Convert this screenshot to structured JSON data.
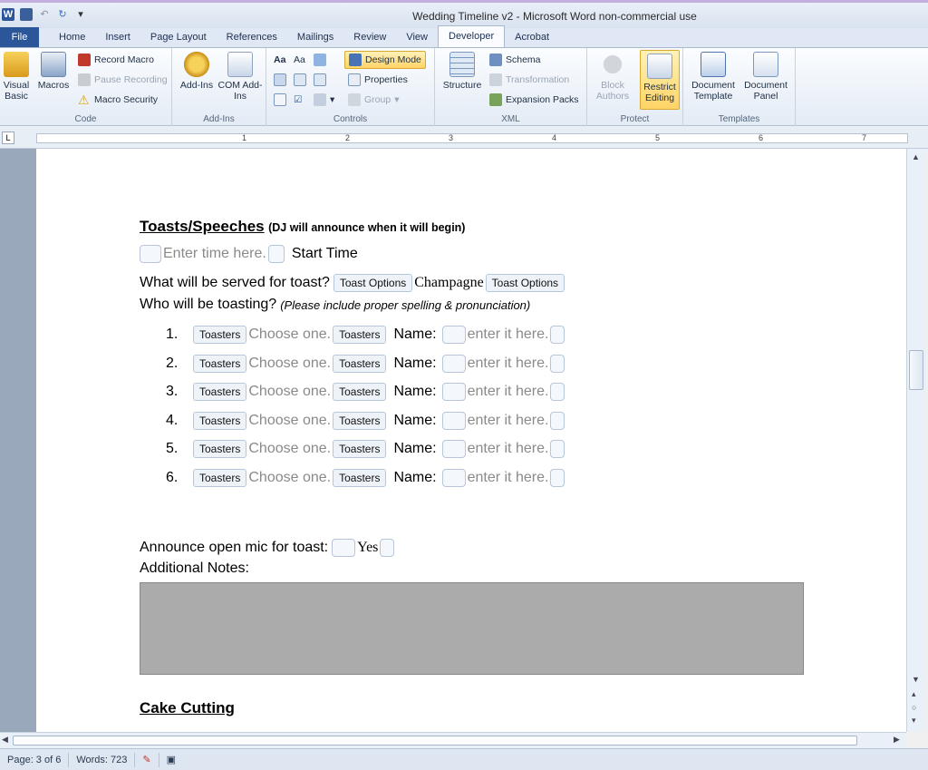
{
  "window": {
    "title": "Wedding Timeline v2 - Microsoft Word non-commercial use"
  },
  "tabs": [
    "File",
    "Home",
    "Insert",
    "Page Layout",
    "References",
    "Mailings",
    "Review",
    "View",
    "Developer",
    "Acrobat"
  ],
  "ribbon": {
    "code": {
      "name": "Code",
      "visual_basic": "Visual Basic",
      "macros": "Macros",
      "record_macro": "Record Macro",
      "pause_recording": "Pause Recording",
      "macro_security": "Macro Security"
    },
    "addins": {
      "name": "Add-Ins",
      "addins": "Add-Ins",
      "com_addins": "COM Add-Ins"
    },
    "controls": {
      "name": "Controls",
      "design_mode": "Design Mode",
      "properties": "Properties",
      "group": "Group"
    },
    "xml": {
      "name": "XML",
      "structure": "Structure",
      "schema": "Schema",
      "transformation": "Transformation",
      "expansion_packs": "Expansion Packs"
    },
    "protect": {
      "name": "Protect",
      "block_authors": "Block Authors",
      "restrict_editing": "Restrict Editing"
    },
    "templates": {
      "name": "Templates",
      "document_template": "Document Template",
      "document_panel": "Document Panel"
    }
  },
  "ruler": {
    "numbers": [
      "1",
      "2",
      "3",
      "4",
      "5",
      "6",
      "7"
    ]
  },
  "document": {
    "toasts_heading": "Toasts/Speeches",
    "toasts_note": "(DJ will announce when it will begin)",
    "time_placeholder": "Enter time here.",
    "start_time": "Start Time",
    "served_question": "What will be served for toast?",
    "toast_options_label": "Toast Options",
    "toast_value": "Champagne",
    "who_question": "Who will be toasting?",
    "who_note": "(Please include proper spelling & pronunciation)",
    "toasters": [
      {
        "num": "1.",
        "tag": "Toasters",
        "choice": "Choose one.",
        "name_label": "Name:",
        "name_placeholder": "enter it here."
      },
      {
        "num": "2.",
        "tag": "Toasters",
        "choice": "Choose one.",
        "name_label": "Name:",
        "name_placeholder": "enter it here."
      },
      {
        "num": "3.",
        "tag": "Toasters",
        "choice": "Choose one.",
        "name_label": "Name:",
        "name_placeholder": "enter it here."
      },
      {
        "num": "4.",
        "tag": "Toasters",
        "choice": "Choose one.",
        "name_label": "Name:",
        "name_placeholder": "enter it here."
      },
      {
        "num": "5.",
        "tag": "Toasters",
        "choice": "Choose one.",
        "name_label": "Name:",
        "name_placeholder": "enter it here."
      },
      {
        "num": "6.",
        "tag": "Toasters",
        "choice": "Choose one.",
        "name_label": "Name:",
        "name_placeholder": "enter it here."
      }
    ],
    "open_mic_label": "Announce open mic for toast:",
    "open_mic_value": "Yes",
    "additional_notes": "Additional Notes:",
    "cake_heading": "Cake Cutting"
  },
  "status": {
    "page": "Page: 3 of 6",
    "words": "Words: 723"
  },
  "colors": {
    "file_tab": "#2b579a",
    "notes_box": "#ababab"
  }
}
